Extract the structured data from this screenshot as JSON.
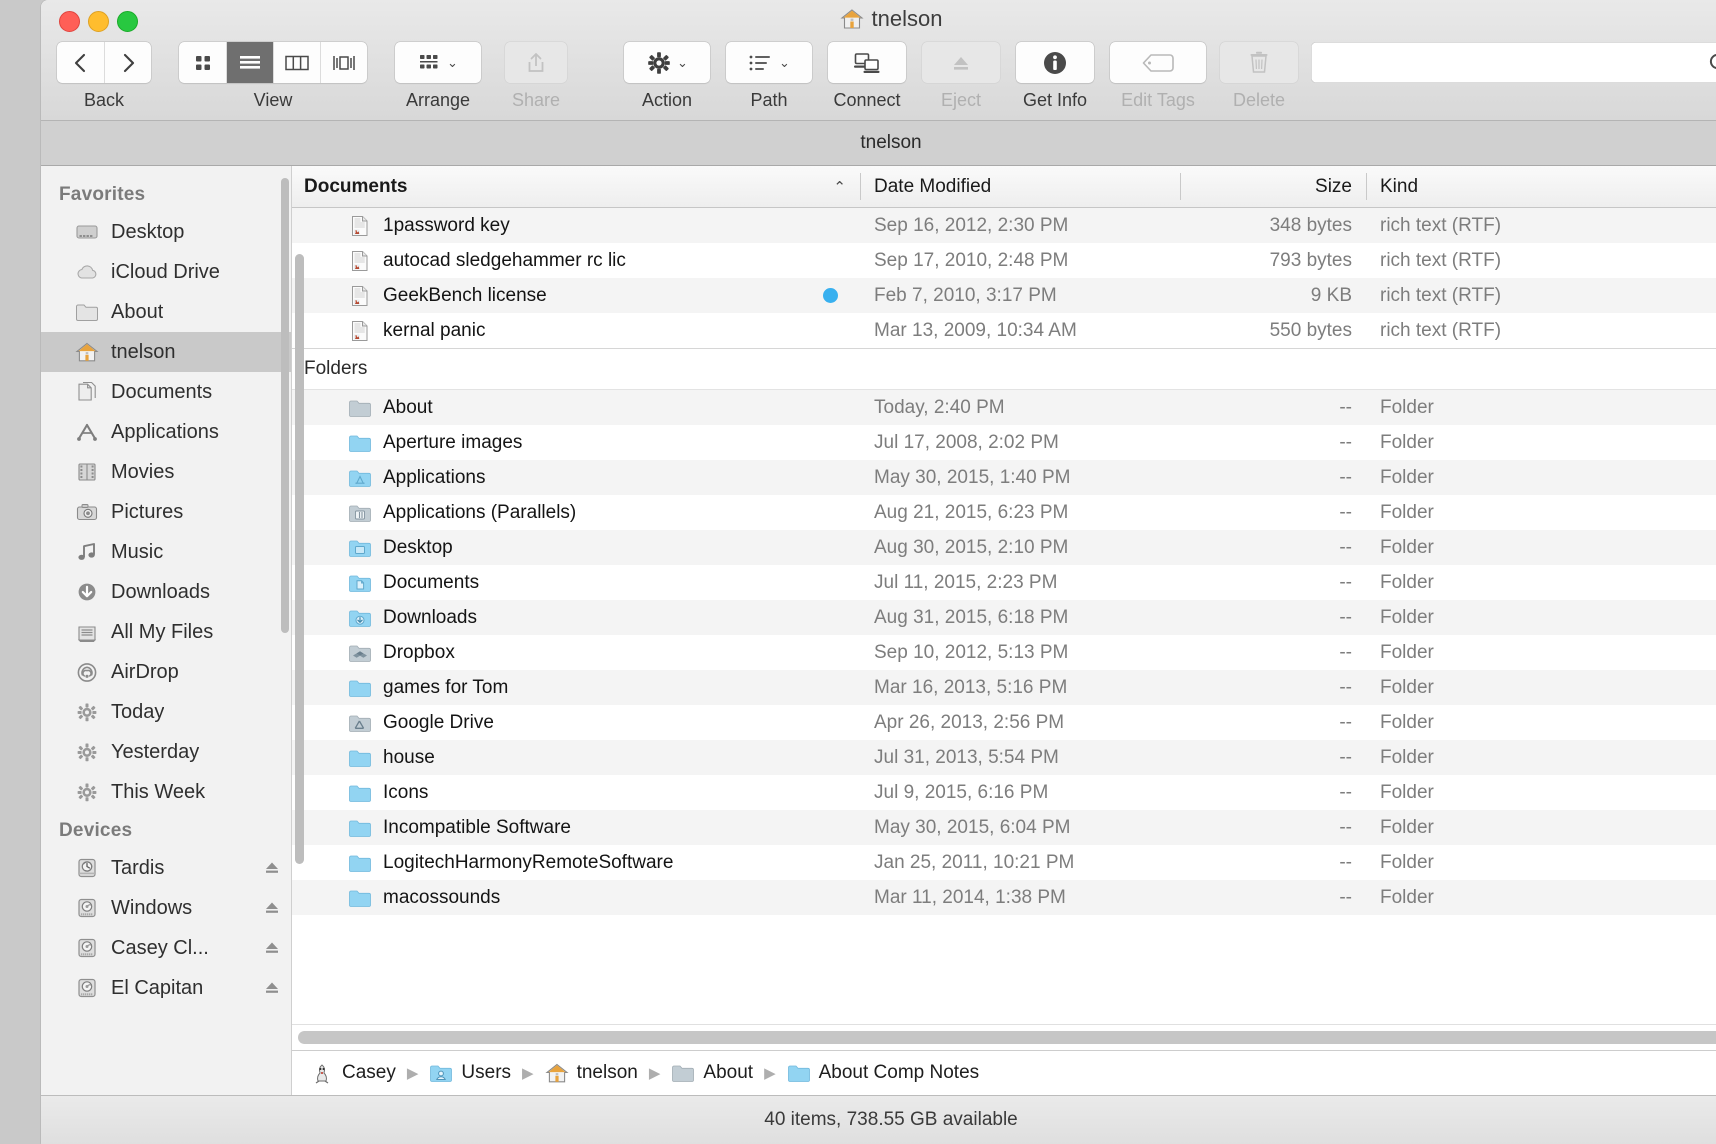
{
  "window": {
    "title": "tnelson",
    "title_icon": "home-icon",
    "subtitle": "tnelson",
    "traffic_lights": [
      "close",
      "minimize",
      "zoom"
    ]
  },
  "toolbar": {
    "back_forward_label": "Back",
    "view_label": "View",
    "view_modes": [
      "icon-view",
      "list-view",
      "column-view",
      "coverflow-view"
    ],
    "view_active": "list-view",
    "arrange_label": "Arrange",
    "share_label": "Share",
    "share_disabled": true,
    "action_label": "Action",
    "path_label": "Path",
    "connect_label": "Connect",
    "eject_label": "Eject",
    "eject_disabled": true,
    "getinfo_label": "Get Info",
    "edittags_label": "Edit Tags",
    "edittags_disabled": true,
    "delete_label": "Delete",
    "delete_disabled": true,
    "search_value": "",
    "search_placeholder": ""
  },
  "sidebar": {
    "sections": [
      {
        "header": "Favorites",
        "items": [
          {
            "label": "Desktop",
            "icon": "desktop-icon",
            "selected": false,
            "eject": false
          },
          {
            "label": "iCloud Drive",
            "icon": "cloud-icon",
            "selected": false,
            "eject": false
          },
          {
            "label": "About",
            "icon": "folder-icon",
            "selected": false,
            "eject": false
          },
          {
            "label": "tnelson",
            "icon": "home-icon",
            "selected": true,
            "eject": false
          },
          {
            "label": "Documents",
            "icon": "documents-icon",
            "selected": false,
            "eject": false
          },
          {
            "label": "Applications",
            "icon": "applications-icon",
            "selected": false,
            "eject": false
          },
          {
            "label": "Movies",
            "icon": "movies-icon",
            "selected": false,
            "eject": false
          },
          {
            "label": "Pictures",
            "icon": "pictures-icon",
            "selected": false,
            "eject": false
          },
          {
            "label": "Music",
            "icon": "music-icon",
            "selected": false,
            "eject": false
          },
          {
            "label": "Downloads",
            "icon": "downloads-icon",
            "selected": false,
            "eject": false
          },
          {
            "label": "All My Files",
            "icon": "allmyfiles-icon",
            "selected": false,
            "eject": false
          },
          {
            "label": "AirDrop",
            "icon": "airdrop-icon",
            "selected": false,
            "eject": false
          },
          {
            "label": "Today",
            "icon": "gear-icon",
            "selected": false,
            "eject": false
          },
          {
            "label": "Yesterday",
            "icon": "gear-icon",
            "selected": false,
            "eject": false
          },
          {
            "label": "This Week",
            "icon": "gear-icon",
            "selected": false,
            "eject": false
          }
        ]
      },
      {
        "header": "Devices",
        "items": [
          {
            "label": "Tardis",
            "icon": "timemachine-disk-icon",
            "selected": false,
            "eject": true
          },
          {
            "label": "Windows",
            "icon": "disk-icon",
            "selected": false,
            "eject": true
          },
          {
            "label": "Casey Cl...",
            "icon": "disk-icon",
            "selected": false,
            "eject": true
          },
          {
            "label": "El Capitan",
            "icon": "disk-icon",
            "selected": false,
            "eject": true
          }
        ]
      }
    ]
  },
  "columns": {
    "name": "Documents",
    "date": "Date Modified",
    "size": "Size",
    "kind": "Kind",
    "sort_arrow": "chevron-up-icon"
  },
  "groups": [
    {
      "title": "Documents",
      "is_column_header": true,
      "rows": [
        {
          "name": "1password key",
          "icon": "rtf-file-icon",
          "date": "Sep 16, 2012, 2:30 PM",
          "size": "348 bytes",
          "kind": "rich text (RTF)",
          "tag_color": ""
        },
        {
          "name": "autocad sledgehammer rc lic",
          "icon": "rtf-file-icon",
          "date": "Sep 17, 2010, 2:48 PM",
          "size": "793 bytes",
          "kind": "rich text (RTF)",
          "tag_color": ""
        },
        {
          "name": "GeekBench license",
          "icon": "rtf-file-icon",
          "date": "Feb 7, 2010, 3:17 PM",
          "size": "9 KB",
          "kind": "rich text (RTF)",
          "tag_color": "#38b0ef"
        },
        {
          "name": "kernal panic",
          "icon": "rtf-file-icon",
          "date": "Mar 13, 2009, 10:34 AM",
          "size": "550 bytes",
          "kind": "rich text (RTF)",
          "tag_color": ""
        }
      ]
    },
    {
      "title": "Folders",
      "is_column_header": false,
      "rows": [
        {
          "name": "About",
          "icon": "folder-gray-icon",
          "date": "Today, 2:40 PM",
          "size": "--",
          "kind": "Folder",
          "tag_color": ""
        },
        {
          "name": "Aperture images",
          "icon": "folder-icon",
          "date": "Jul 17, 2008, 2:02 PM",
          "size": "--",
          "kind": "Folder",
          "tag_color": ""
        },
        {
          "name": "Applications",
          "icon": "folder-apps-icon",
          "date": "May 30, 2015, 1:40 PM",
          "size": "--",
          "kind": "Folder",
          "tag_color": ""
        },
        {
          "name": "Applications (Parallels)",
          "icon": "folder-parallels-icon",
          "date": "Aug 21, 2015, 6:23 PM",
          "size": "--",
          "kind": "Folder",
          "tag_color": ""
        },
        {
          "name": "Desktop",
          "icon": "folder-desktop-icon",
          "date": "Aug 30, 2015, 2:10 PM",
          "size": "--",
          "kind": "Folder",
          "tag_color": ""
        },
        {
          "name": "Documents",
          "icon": "folder-documents-icon",
          "date": "Jul 11, 2015, 2:23 PM",
          "size": "--",
          "kind": "Folder",
          "tag_color": ""
        },
        {
          "name": "Downloads",
          "icon": "folder-downloads-icon",
          "date": "Aug 31, 2015, 6:18 PM",
          "size": "--",
          "kind": "Folder",
          "tag_color": ""
        },
        {
          "name": "Dropbox",
          "icon": "folder-dropbox-icon",
          "date": "Sep 10, 2012, 5:13 PM",
          "size": "--",
          "kind": "Folder",
          "tag_color": ""
        },
        {
          "name": "games for Tom",
          "icon": "folder-icon",
          "date": "Mar 16, 2013, 5:16 PM",
          "size": "--",
          "kind": "Folder",
          "tag_color": ""
        },
        {
          "name": "Google Drive",
          "icon": "folder-gdrive-icon",
          "date": "Apr 26, 2013, 2:56 PM",
          "size": "--",
          "kind": "Folder",
          "tag_color": ""
        },
        {
          "name": "house",
          "icon": "folder-icon",
          "date": "Jul 31, 2013, 5:54 PM",
          "size": "--",
          "kind": "Folder",
          "tag_color": ""
        },
        {
          "name": "Icons",
          "icon": "folder-icon",
          "date": "Jul 9, 2015, 6:16 PM",
          "size": "--",
          "kind": "Folder",
          "tag_color": ""
        },
        {
          "name": "Incompatible Software",
          "icon": "folder-icon",
          "date": "May 30, 2015, 6:04 PM",
          "size": "--",
          "kind": "Folder",
          "tag_color": ""
        },
        {
          "name": "LogitechHarmonyRemoteSoftware",
          "icon": "folder-icon",
          "date": "Jan 25, 2011, 10:21 PM",
          "size": "--",
          "kind": "Folder",
          "tag_color": ""
        },
        {
          "name": "macossounds",
          "icon": "folder-icon",
          "date": "Mar 11, 2014, 1:38 PM",
          "size": "--",
          "kind": "Folder",
          "tag_color": ""
        }
      ]
    }
  ],
  "path_bar": {
    "crumbs": [
      {
        "label": "Casey",
        "icon": "volume-icon"
      },
      {
        "label": "Users",
        "icon": "users-folder-icon"
      },
      {
        "label": "tnelson",
        "icon": "home-icon"
      },
      {
        "label": "About",
        "icon": "folder-gray-icon"
      },
      {
        "label": "About Comp Notes",
        "icon": "folder-icon"
      }
    ],
    "separator": "chevron-right-icon"
  },
  "status_bar": {
    "text": "40 items, 738.55 GB available"
  }
}
